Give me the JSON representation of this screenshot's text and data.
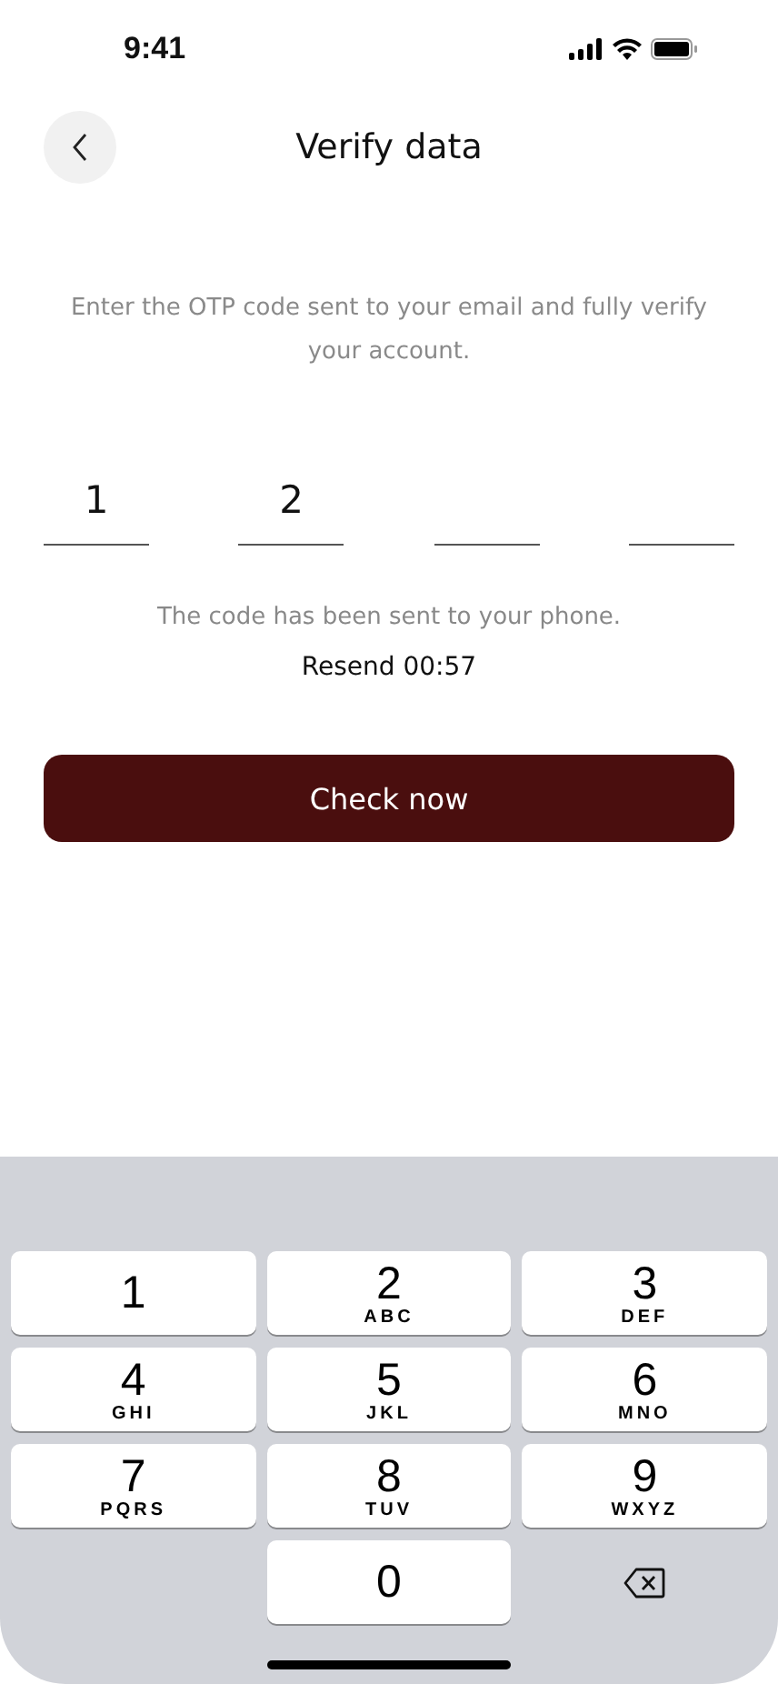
{
  "status_bar": {
    "time": "9:41"
  },
  "header": {
    "title": "Verify data"
  },
  "description": "Enter the OTP code sent to your email and fully verify your account.",
  "otp": [
    {
      "kind": "filled",
      "value": "1"
    },
    {
      "kind": "filled",
      "value": "2"
    },
    {
      "kind": "empty"
    },
    {
      "kind": "empty"
    }
  ],
  "sent_note": "The code has been sent to your phone.",
  "resend": "Resend 00:57",
  "submit": "Check now",
  "keypad": [
    {
      "kind": "digit",
      "digit": "1"
    },
    {
      "kind": "digit",
      "digit": "2",
      "letters": "ABC"
    },
    {
      "kind": "digit",
      "digit": "3",
      "letters": "DEF"
    },
    {
      "kind": "digit",
      "digit": "4",
      "letters": "GHI"
    },
    {
      "kind": "digit",
      "digit": "5",
      "letters": "JKL"
    },
    {
      "kind": "digit",
      "digit": "6",
      "letters": "MNO"
    },
    {
      "kind": "digit",
      "digit": "7",
      "letters": "PQRS"
    },
    {
      "kind": "digit",
      "digit": "8",
      "letters": "TUV"
    },
    {
      "kind": "digit",
      "digit": "9",
      "letters": "WXYZ"
    },
    {
      "kind": "blank"
    },
    {
      "kind": "digit",
      "digit": "0"
    },
    {
      "kind": "backspace"
    }
  ]
}
